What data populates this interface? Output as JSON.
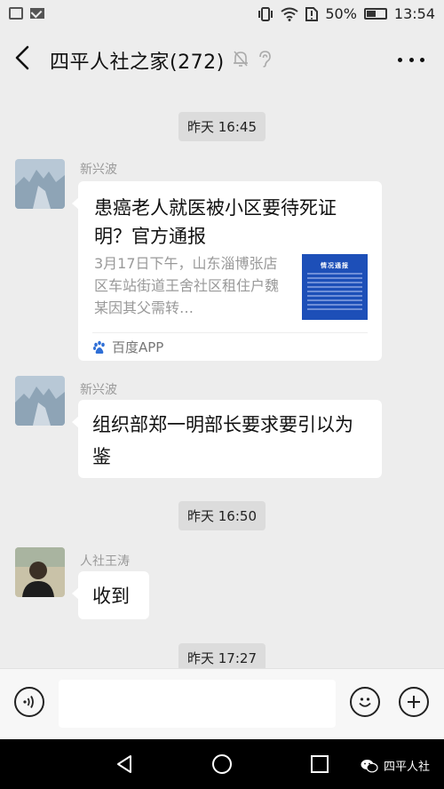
{
  "status_bar": {
    "battery": "50%",
    "battery_level": 0.5,
    "time": "13:54"
  },
  "header": {
    "title": "四平人社之家(272)"
  },
  "messages": {
    "t1": "昨天 16:45",
    "m1": {
      "sender": "新兴波",
      "card_title": "患癌老人就医被小区要待死证明？官方通报",
      "card_desc": "3月17日下午，山东淄博张店区车站街道王舍社区租住户魏某因其父需转…",
      "thumb_title": "情况通报",
      "source": "百度APP"
    },
    "m2": {
      "sender": "新兴波",
      "text": "组织部郑一明部长要求要引以为鉴"
    },
    "t2": "昨天 16:50",
    "m3": {
      "sender": "人社王涛",
      "text": "收到"
    },
    "t3": "昨天 17:27"
  },
  "input": {
    "placeholder": ""
  },
  "watermark": {
    "text": "四平人社"
  },
  "colors": {
    "background": "#ededed",
    "bubble": "#ffffff",
    "card_thumb": "#1d4fb8",
    "navbar": "#000000"
  }
}
